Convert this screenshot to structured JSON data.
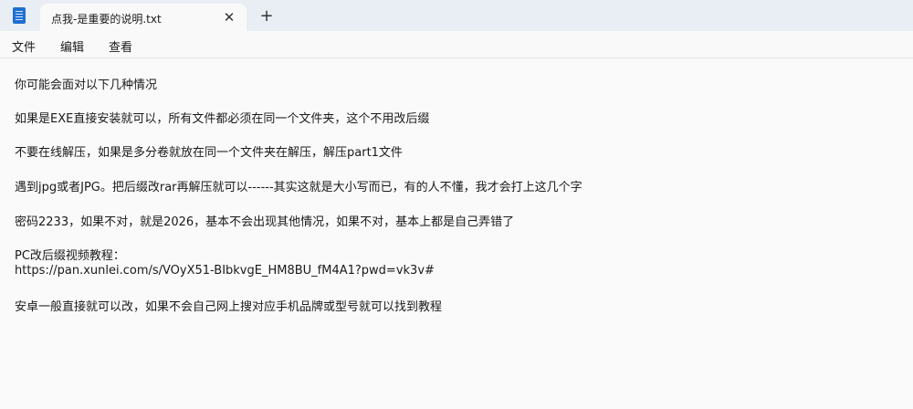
{
  "window": {
    "tab_title": "点我-是重要的说明.txt",
    "close_glyph": "✕",
    "new_tab_glyph": "+",
    "icons": {
      "app": "notepad-icon",
      "close": "close-icon",
      "new_tab": "plus-icon"
    }
  },
  "menu": {
    "items": [
      "文件",
      "编辑",
      "查看"
    ]
  },
  "editor": {
    "lines": [
      "你可能会面对以下几种情况",
      "如果是EXE直接安装就可以，所有文件都必须在同一个文件夹，这个不用改后缀",
      "不要在线解压，如果是多分卷就放在同一个文件夹在解压，解压part1文件",
      "遇到jpg或者JPG。把后缀改rar再解压就可以------其实这就是大小写而已，有的人不懂，我才会打上这几个字",
      "密码2233，如果不对，就是2026，基本不会出现其他情况，如果不对，基本上都是自己弄错了",
      "PC改后缀视频教程：",
      "https://pan.xunlei.com/s/VOyX51-BIbkvgE_HM8BU_fM4A1?pwd=vk3v#",
      "安卓一般直接就可以改，如果不会自己网上搜对应手机品牌或型号就可以找到教程"
    ]
  }
}
